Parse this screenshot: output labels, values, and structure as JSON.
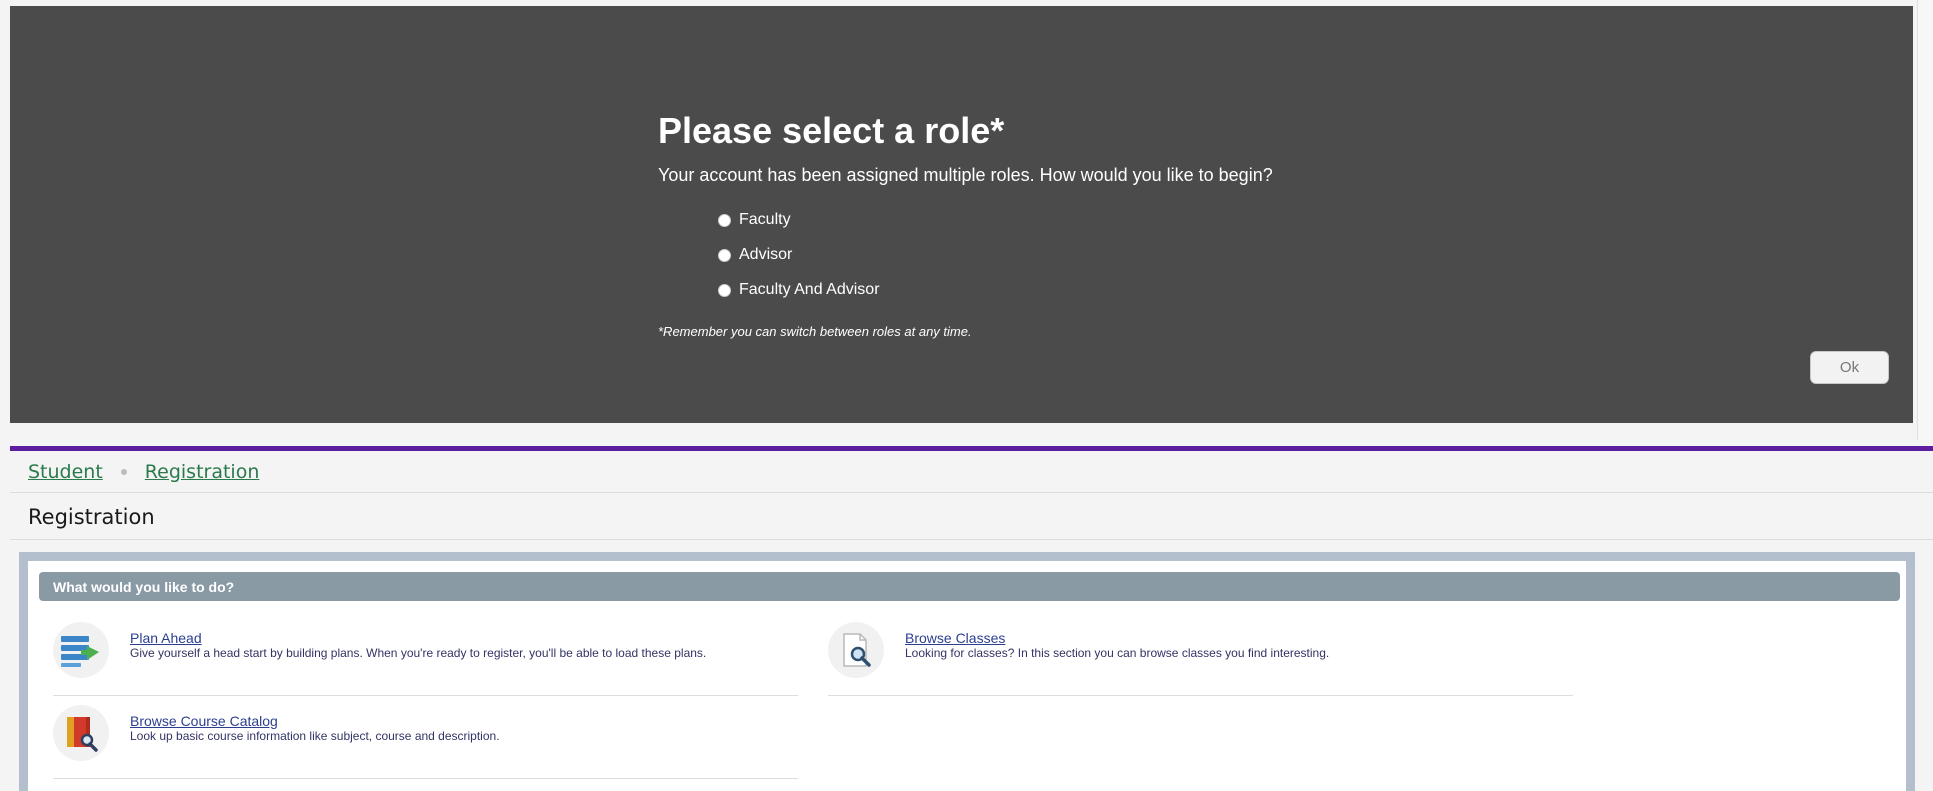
{
  "modal": {
    "title": "Please select a role*",
    "description": "Your account has been assigned multiple roles. How would you like to begin?",
    "roles": [
      "Faculty",
      "Advisor",
      "Faculty And Advisor"
    ],
    "note": "*Remember you can switch between roles at any time.",
    "ok_label": "Ok"
  },
  "breadcrumb": {
    "items": [
      "Student",
      "Registration"
    ]
  },
  "page_title": "Registration",
  "panel": {
    "header": "What would you like to do?",
    "actions": [
      {
        "title": "Plan Ahead",
        "description": "Give yourself a head start by building plans. When you're ready to register, you'll be able to load these plans.",
        "icon": "plan-ahead-icon"
      },
      {
        "title": "Browse Classes",
        "description": "Looking for classes? In this section you can browse classes you find interesting.",
        "icon": "browse-classes-icon"
      },
      {
        "title": "Browse Course Catalog",
        "description": "Look up basic course information like subject, course and description.",
        "icon": "course-catalog-icon"
      }
    ]
  },
  "colors": {
    "modal_bg": "#4b4b4b",
    "accent_purple": "#5a1e9e",
    "breadcrumb_link": "#2a7a4b",
    "panel_header": "#8a9aa5"
  }
}
